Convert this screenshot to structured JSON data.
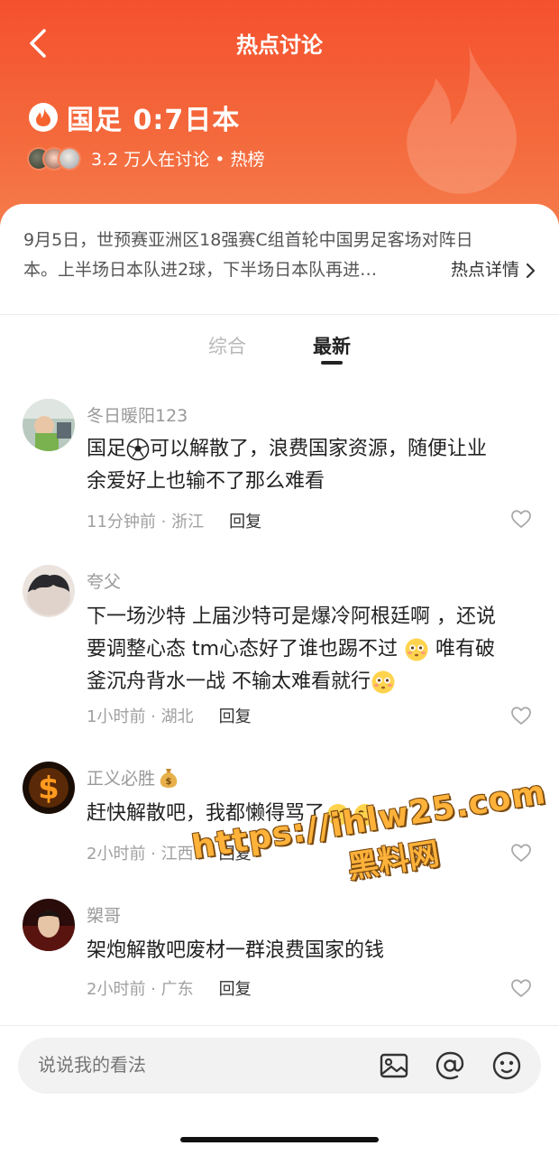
{
  "header": {
    "title": "热点讨论",
    "topic_title": "国足 0:7日本",
    "meta_text": "3.2 万人在讨论 • 热榜"
  },
  "summary": {
    "line1": "9月5日，世预赛亚洲区18强赛C组首轮中国男足客场对阵日",
    "line2": "本。上半场日本队进2球，下半场日本队再进…",
    "detail_link": "热点详情"
  },
  "tabs": [
    {
      "label": "综合",
      "active": false
    },
    {
      "label": "最新",
      "active": true
    }
  ],
  "comments": [
    {
      "name": "冬日暖阳123",
      "body_lines": [
        "国足",
        "可以解散了，浪费国家资源，随便让业",
        "余爱好上也输不了那么难看"
      ],
      "time_loc": "11分钟前 · 浙江",
      "reply": "回复",
      "avatar_icon": "child-photo-avatar"
    },
    {
      "name": "夸父",
      "body_lines": [
        "下一场沙特 上届沙特可是爆冷阿根廷啊 ，还说",
        "要调整心态 tm心态好了谁也踢不过 ",
        " 唯有破",
        "釜沉舟背水一战 不输太难看就行"
      ],
      "time_loc": "1小时前 · 湖北",
      "reply": "回复",
      "avatar_icon": "hair-photo-avatar"
    },
    {
      "name": "正义必胜",
      "body_lines": [
        "赶快解散吧，我都懒得骂了"
      ],
      "time_loc": "2小时前 · 江西",
      "reply": "回复",
      "avatar_icon": "dollar-sign-avatar"
    },
    {
      "name": "槊哥",
      "body_lines": [
        "架炮解散吧废材一群浪费国家的钱"
      ],
      "time_loc": "2小时前 · 广东",
      "reply": "回复",
      "avatar_icon": "man-photo-avatar"
    }
  ],
  "input": {
    "placeholder": "说说我的看法"
  },
  "watermark": {
    "line1": "https://ihlw25.com",
    "line2": "黑料网"
  },
  "colors": {
    "header_orange": "#f5512e",
    "accent": "#ff6a3c"
  }
}
